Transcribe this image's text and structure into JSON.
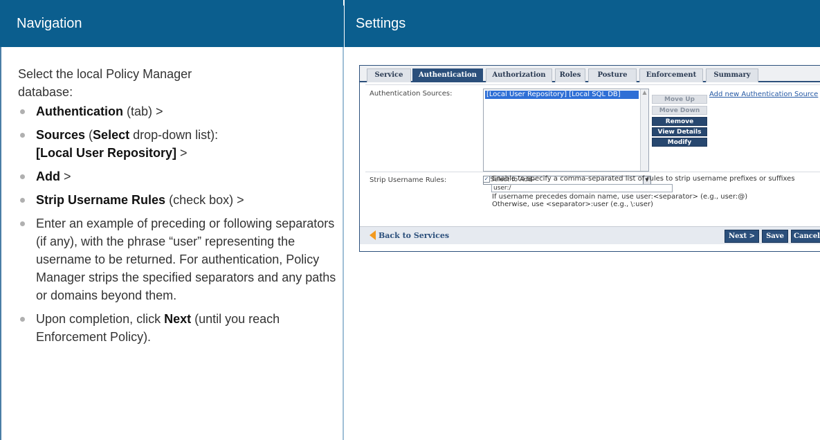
{
  "headers": {
    "navigation": "Navigation",
    "settings": "Settings"
  },
  "nav": {
    "intro": "Select the local Policy Manager database:",
    "b1_bold": "Authentication",
    "b1_rest": " (tab) >",
    "b2_bold1": "Sources",
    "b2_mid": " (",
    "b2_bold2": "Select",
    "b2_rest": " drop-down list):",
    "b2_bold3": "[Local User Repository]",
    "b2_end": " >",
    "b3_bold": "Add",
    "b3_rest": " >",
    "b4_bold": "Strip Username Rules",
    "b4_rest": " (check box) >",
    "b5": "Enter an example of preceding or following separators (if any), with the phrase “user” representing the username to be returned. For authentication, Policy Manager strips the specified separators and any paths or domains beyond them.",
    "b6_pre": "Upon completion, click ",
    "b6_bold": "Next",
    "b6_rest": " (until you reach Enforcement Policy)."
  },
  "shot": {
    "tabs": [
      "Service",
      "Authentication",
      "Authorization",
      "Roles",
      "Posture",
      "Enforcement",
      "Summary"
    ],
    "active_tab": "Authentication",
    "auth_sources_label": "Authentication Sources:",
    "auth_sources_selected": "[Local User Repository] [Local SQL DB]",
    "select_placeholder": "--Select to Add--",
    "buttons": {
      "move_up": "Move Up",
      "move_down": "Move Down",
      "remove": "Remove",
      "view_details": "View Details",
      "modify": "Modify"
    },
    "add_link": "Add new Authentication Source",
    "strip_label": "Strip Username Rules:",
    "strip_checkbox_text": "Enable to specify a comma-separated list of rules to strip username prefixes or suffixes",
    "strip_value": "user:/",
    "hint1": "If username precedes domain name, use user:<separator> (e.g., user:@)",
    "hint2": "Otherwise, use <separator>:user (e.g., \\:user)",
    "back": "Back to Services",
    "next": "Next >",
    "save": "Save",
    "cancel": "Cancel"
  }
}
